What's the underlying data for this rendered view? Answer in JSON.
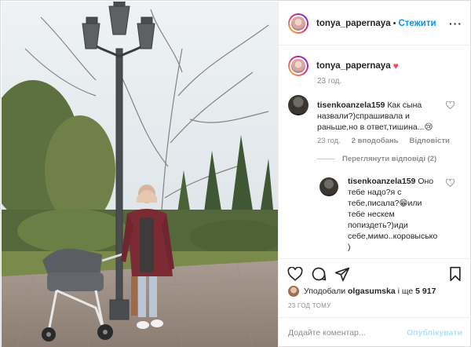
{
  "header": {
    "username": "tonya_papernaya",
    "separator": "•",
    "follow_label": "Стежити",
    "more_label": "···"
  },
  "caption": {
    "username": "tonya_papernaya",
    "emoji": "♥",
    "time": "23 год."
  },
  "comments": [
    {
      "username": "tisenkoanzela159",
      "text": "Как сына назвали?)спрашивала и раньше,но в ответ,тишина...😢",
      "time": "23 год.",
      "likes": "2 вподобань",
      "reply_label": "Відповісти",
      "view_replies_label": "Переглянути відповіді (2)"
    }
  ],
  "reply": {
    "username": "tisenkoanzela159",
    "text": "Оно тебе надо?я с тебе,писала?😁или тебе нескем попиздеть?)иди себе,мимо..коровысько )"
  },
  "actions": {
    "like_icon": "heart-outline-icon",
    "comment_icon": "comment-icon",
    "share_icon": "paper-plane-icon",
    "save_icon": "bookmark-icon"
  },
  "likes": {
    "prefix": "Уподобали",
    "user": "olgasumska",
    "middle": "і ще",
    "count": "5 917"
  },
  "time_ago": "23 ГОД ТОМУ",
  "add_comment": {
    "placeholder": "Додайте коментар...",
    "publish_label": "Опублікувати"
  },
  "colors": {
    "accent": "#0095f6",
    "publish_disabled": "#b2dffc",
    "heart": "#ed4956",
    "muted": "#8e8e8e"
  }
}
